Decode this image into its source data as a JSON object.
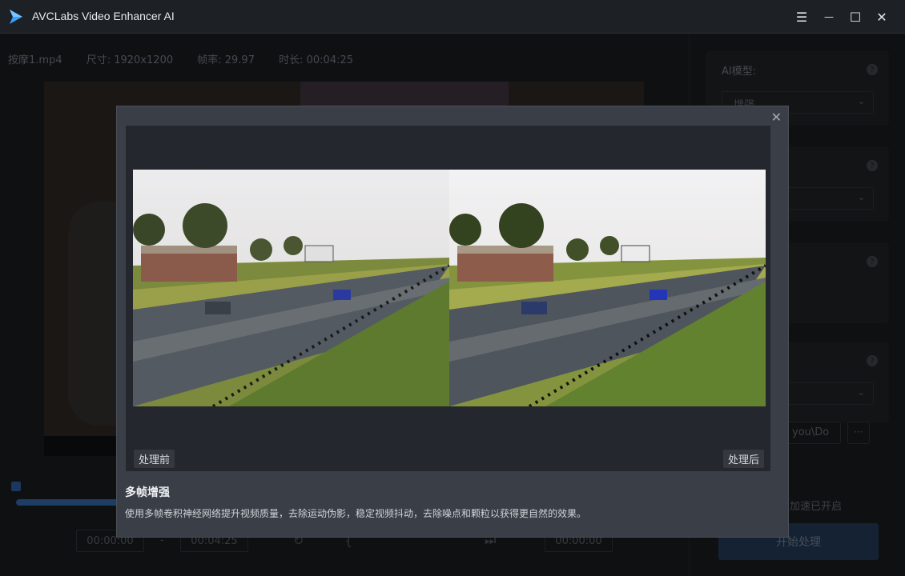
{
  "app": {
    "title": "AVCLabs Video Enhancer AI"
  },
  "window_controls": {
    "menu": "☰",
    "minimize": "—",
    "maximize": "☐",
    "close": "✕"
  },
  "file_info": {
    "filename": "按摩1.mp4",
    "size": "尺寸: 1920x1200",
    "framerate": "帧率: 29.97",
    "duration": "时长: 00:04:25"
  },
  "timeline": {
    "start_time": "00:00:00",
    "separator": "-",
    "end_time": "00:04:25",
    "right_time": "00:00:00"
  },
  "right_panel": {
    "ai_model_label": "AI模型:",
    "ai_model_value": "增强",
    "path_value": "you\\Do",
    "more_label": "···",
    "accel_text": "加速已开启",
    "start_button": "开始处理"
  },
  "modal": {
    "close_icon": "✕",
    "before_label": "处理前",
    "after_label": "处理后",
    "title": "多帧增强",
    "description": "使用多帧卷积神经网络提升视频质量，去除运动伪影，稳定视频抖动，去除噪点和颗粒以获得更自然的效果。"
  },
  "colors": {
    "background": "#16191d",
    "modal_bg": "#3a3f47",
    "accent": "#2f5f9c"
  }
}
